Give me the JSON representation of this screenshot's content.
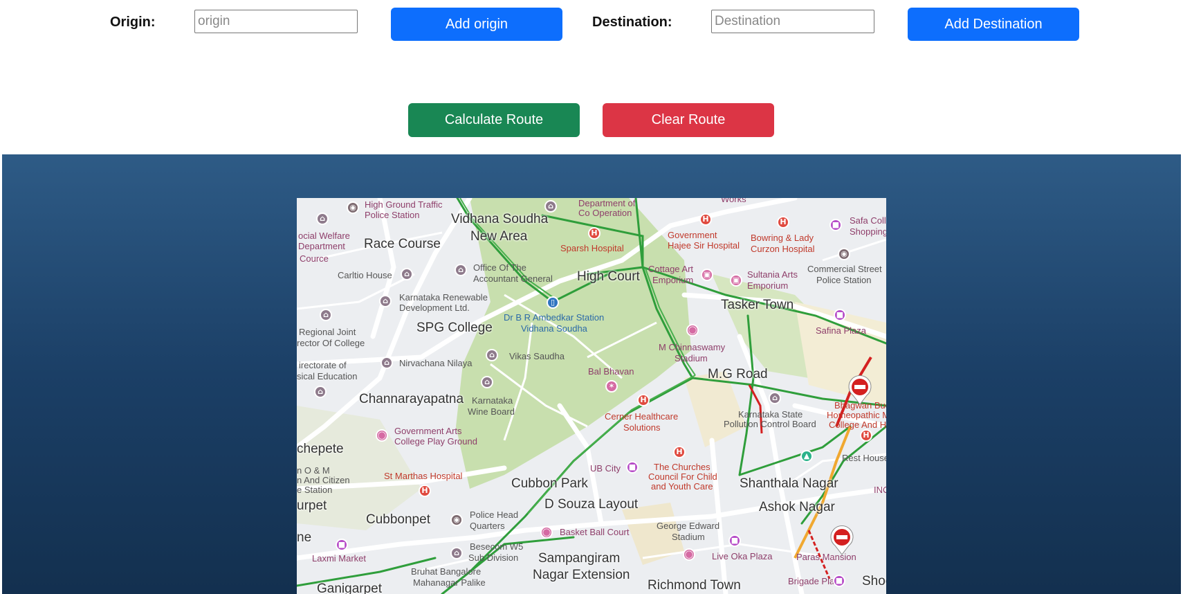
{
  "form": {
    "origin_label": "Origin:",
    "origin_placeholder": "origin",
    "add_origin": "Add origin",
    "destination_label": "Destination:",
    "destination_placeholder": "Destination",
    "add_destination": "Add Destination",
    "calculate": "Calculate Route",
    "clear": "Clear Route"
  },
  "colors": {
    "primary": "#0d6efd",
    "success": "#198754",
    "danger": "#dc3545",
    "stage_top": "#2e5b86",
    "stage_bottom": "#13304f"
  },
  "map": {
    "areas": {
      "vidhana": "Vidhana Soudha",
      "newarea": "New Area",
      "race": "Race Course",
      "highcourt": "High Court",
      "tasker": "Tasker Town",
      "spg": "SPG College",
      "mg": "M.G Road",
      "channa": "Channarayapatna",
      "chepete": "chepete",
      "cubbonpark": "Cubbon Park",
      "dsouza": "D Souza Layout",
      "shanthala": "Shanthala Nagar",
      "ashok": "Ashok Nagar",
      "urpet": "urpet",
      "cubbonpet": "Cubbonpet",
      "ne": "ne",
      "sampangiram": "Sampangiram",
      "nagarext": "Nagar Extension",
      "richmond": "Richmond Town",
      "ganigarpet": "Ganigarpet",
      "shoo": "Shoo"
    },
    "places": {
      "traffic": "High Ground Traffic",
      "traffic2": "Police Station",
      "deptco": "Department of",
      "deptco2": "Co Operation",
      "works": "Works",
      "socialwelfare": "ocial Welfare",
      "department": "Department",
      "cource": "Cource",
      "sparsh": "Sparsh Hospital",
      "govhajee": "Government",
      "govhajee2": "Hajee Sir Hospital",
      "bowring": "Bowring & Lady",
      "bowring2": "Curzon Hospital",
      "safa": "Safa Coll",
      "safa2": "Shopping",
      "carltio": "Carltio House",
      "officeag": "Office Of The",
      "officeag2": "Accountant General",
      "cottage": "Cottage Art",
      "cottage2": "Emporium",
      "sultania": "Sultania Arts",
      "sultania2": "Emporium",
      "commercial": "Commercial Street",
      "commercial2": "Police Station",
      "karnataka_renew": "Karnataka Renewable",
      "karnataka_renew2": "Development Ltd.",
      "ambedkar": "Dr B R Ambedkar Station",
      "ambedkar2": "Vidhana Soudha",
      "regional": "Regional Joint",
      "regional2": "rector Of College",
      "safina": "Safina Plaza",
      "chinnaswamy": "M Chinnaswamy",
      "chinnaswamy2": "Stadium",
      "nirvachana": "Nirvachana Nilaya",
      "vikas": "Vikas Saudha",
      "directorate": "irectorate of",
      "directorate2": "sical Education",
      "balbhavan": "Bal Bhavan",
      "karnataka_wine": "Karnataka",
      "karnataka_wine2": "Wine Board",
      "kspcb": "Karnataka State",
      "kspcb2": "Pollution Control Board",
      "cerner": "Cerner Healthcare",
      "cerner2": "Solutions",
      "bhagwan": "Bhagwan Bud",
      "bhagwan2": "Homeopathic M",
      "bhagwan3": "College And Hos",
      "govarts": "Government Arts",
      "govarts2": "College Play Ground",
      "churches": "The Churches",
      "churches2": "Council For Child",
      "churches3": "and Youth Care",
      "ubcity": "UB City",
      "resthouse": "Rest House Par",
      "stmarthas": "St Marthas Hospital",
      "om": "n O & M",
      "citizen": "n And Citizen",
      "station": "e Station",
      "policehead": "Police Head",
      "policehead2": "Quarters",
      "georgeedward": "George Edward",
      "georgeedward2": "Stadium",
      "inc": "INC",
      "basketball": "Basket Ball Court",
      "laxmi": "Laxmi Market",
      "besecom": "Besecom W5",
      "besecom2": "Sub Division",
      "liveoka": "Live Oka Plaza",
      "paras": "Paras Mansion",
      "bruhat": "Bruhat Bangalore",
      "bruhat2": "Mahanagar Palike",
      "brigade": "Brigade Place"
    }
  }
}
